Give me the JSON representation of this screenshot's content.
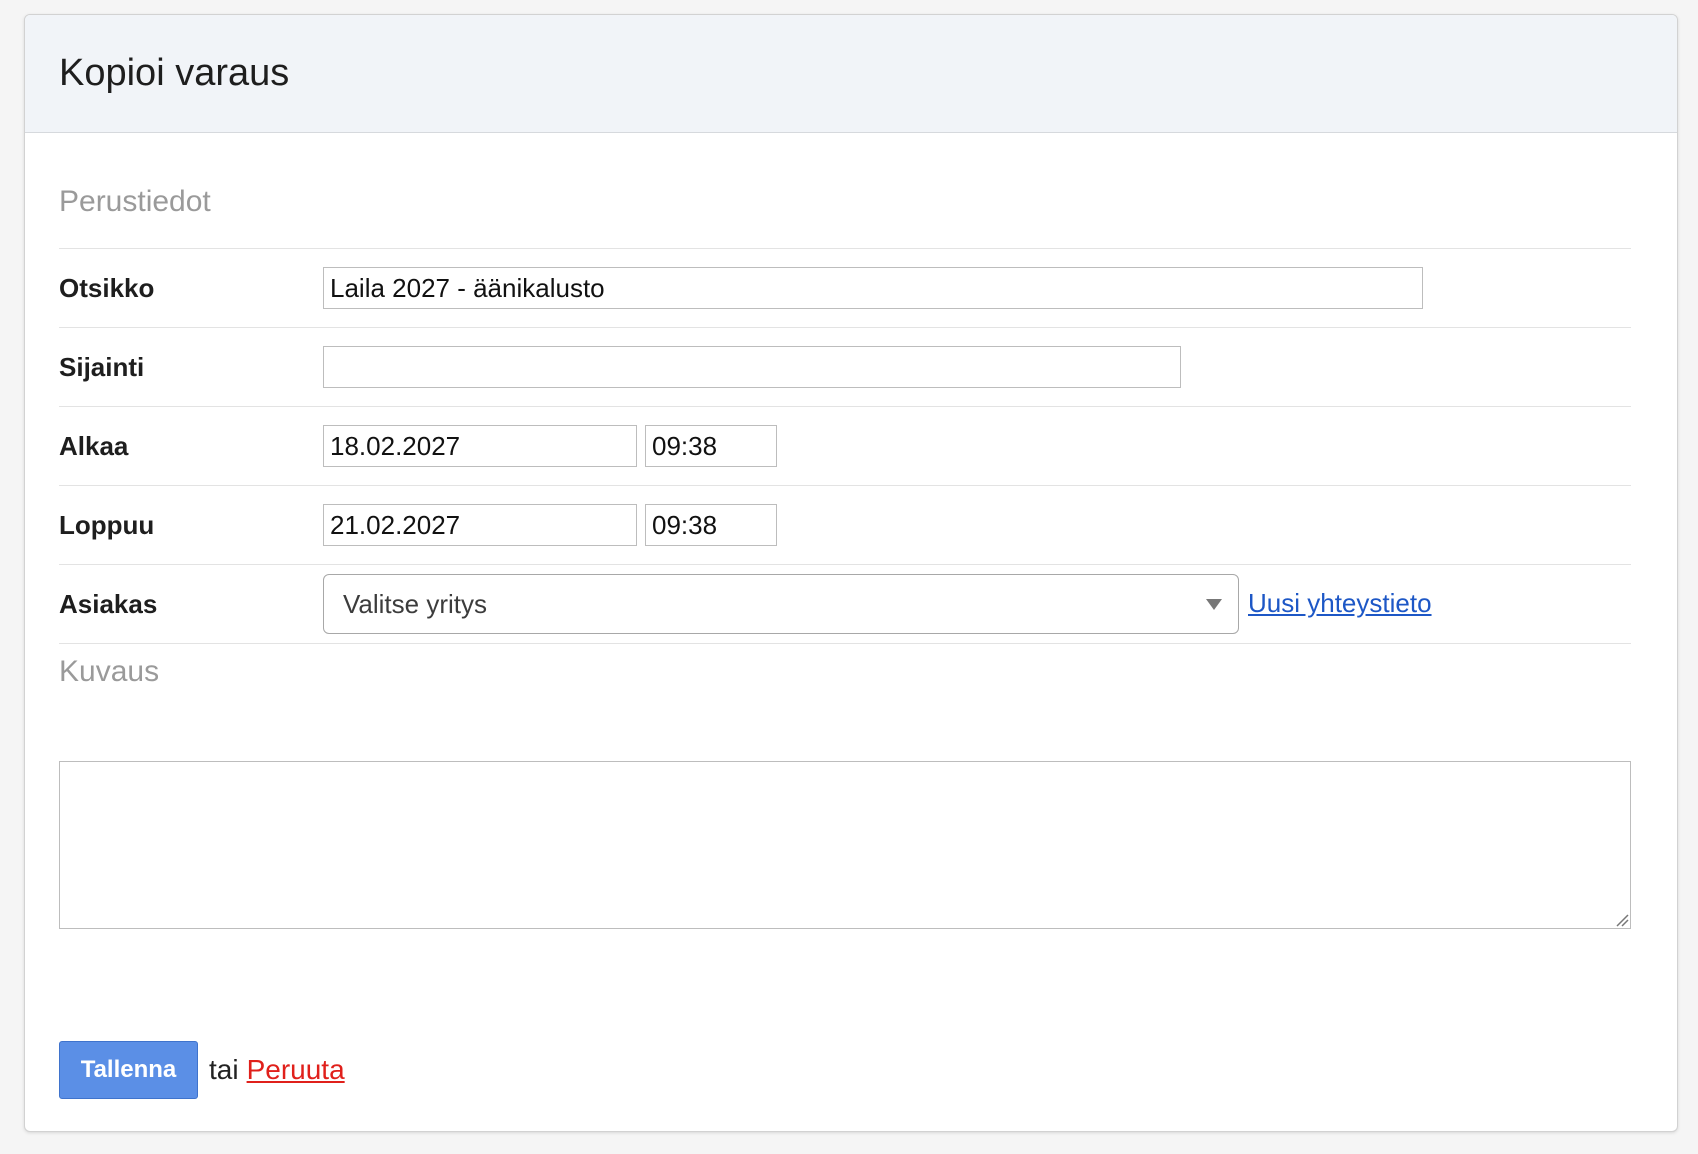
{
  "header": {
    "title": "Kopioi varaus"
  },
  "basic_section": {
    "title": "Perustiedot",
    "title_field": {
      "label": "Otsikko",
      "value": "Laila 2027 - äänikalusto"
    },
    "location_field": {
      "label": "Sijainti",
      "value": ""
    },
    "start": {
      "label": "Alkaa",
      "date": "18.02.2027",
      "time": "09:38"
    },
    "end": {
      "label": "Loppuu",
      "date": "21.02.2027",
      "time": "09:38"
    },
    "customer": {
      "label": "Asiakas",
      "selected": "Valitse yritys",
      "new_contact_link": "Uusi yhteystieto"
    }
  },
  "description_section": {
    "title": "Kuvaus",
    "value": ""
  },
  "actions": {
    "save_label": "Tallenna",
    "or_text": "tai",
    "cancel_label": "Peruuta"
  }
}
